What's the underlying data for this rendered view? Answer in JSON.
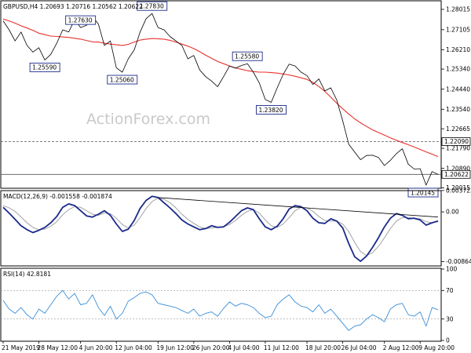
{
  "header": {
    "price_title": "GBPUSD,H4  1.20693 1.20716 1.20562 1.20622",
    "macd_title": "MACD(12,26,9) -0.001558 -0.001874",
    "rsi_title": "RSI(14) 42.8181"
  },
  "watermark": "ActionForex.com",
  "colors": {
    "price": "#000000",
    "sma": "#e8322d",
    "macd": "#1a2a8c",
    "signal": "#9a9a9a",
    "trendline": "#000000",
    "rsi": "#3a8fd8",
    "label_border": "#1a2a8c",
    "current_price_box": "#000000"
  },
  "chart_data": [
    {
      "type": "line",
      "panel": "price",
      "ylim": [
        1.2,
        1.284
      ],
      "y_ticks": [
        "1.28015",
        "1.27105",
        "1.26210",
        "1.25340",
        "1.24440",
        "1.23540",
        "1.22665",
        "1.21790",
        "1.20890",
        "1.20015"
      ],
      "y_tick_values": [
        1.28015,
        1.27105,
        1.2621,
        1.2534,
        1.2444,
        1.2354,
        1.22665,
        1.2179,
        1.2089,
        1.20015
      ],
      "highlight_levels": [
        {
          "label": "1.22090",
          "value": 1.2209,
          "style": "dashed"
        },
        {
          "label": "1.20622",
          "value": 1.20622,
          "style": "solid",
          "box": true
        }
      ],
      "series": [
        {
          "key": "close",
          "color": "#000000",
          "values": [
            1.275,
            1.271,
            1.266,
            1.27,
            1.264,
            1.261,
            1.263,
            1.2575,
            1.26,
            1.265,
            1.271,
            1.27,
            1.2755,
            1.272,
            1.273,
            1.277,
            1.2735,
            1.264,
            1.266,
            1.254,
            1.252,
            1.258,
            1.262,
            1.27,
            1.276,
            1.2783,
            1.272,
            1.271,
            1.268,
            1.266,
            1.264,
            1.258,
            1.2595,
            1.253,
            1.25,
            1.248,
            1.2455,
            1.25,
            1.2548,
            1.2538,
            1.255,
            1.2558,
            1.252,
            1.2472,
            1.2398,
            1.2385,
            1.245,
            1.251,
            1.2556,
            1.2548,
            1.252,
            1.2505,
            1.2465,
            1.249,
            1.2436,
            1.245,
            1.2395,
            1.2302,
            1.2198,
            1.2162,
            1.2128,
            1.2147,
            1.2148,
            1.2138,
            1.2102,
            1.2125,
            1.2155,
            1.2177,
            1.2108,
            1.2086,
            1.2088,
            1.2014,
            1.2075,
            1.2062
          ]
        },
        {
          "key": "sma",
          "name": "",
          "color": "#e8322d",
          "values": [
            1.2758,
            1.275,
            1.274,
            1.2728,
            1.2718,
            1.2708,
            1.2695,
            1.2688,
            1.2682,
            1.268,
            1.2678,
            1.2676,
            1.2672,
            1.2668,
            1.2662,
            1.2656,
            1.2655,
            1.265,
            1.2646,
            1.2643,
            1.264,
            1.2645,
            1.2655,
            1.2664,
            1.2668,
            1.2671,
            1.267,
            1.2668,
            1.2663,
            1.2655,
            1.2646,
            1.2637,
            1.2626,
            1.2612,
            1.2596,
            1.2582,
            1.2568,
            1.2558,
            1.2548,
            1.2539,
            1.2533,
            1.2527,
            1.2523,
            1.252,
            1.252,
            1.2518,
            1.2516,
            1.2512,
            1.2508,
            1.2502,
            1.2495,
            1.2488,
            1.2474,
            1.2456,
            1.2434,
            1.2408,
            1.2381,
            1.2356,
            1.2333,
            1.2311,
            1.2293,
            1.2277,
            1.2262,
            1.225,
            1.2238,
            1.2226,
            1.2215,
            1.2205,
            1.2195,
            1.2185,
            1.2174,
            1.2163,
            1.2153,
            1.2142
          ]
        }
      ],
      "annotations": [
        {
          "text": "1.27630",
          "index": 13,
          "pos": "above"
        },
        {
          "text": "1.25590",
          "index": 7,
          "pos": "below"
        },
        {
          "text": "1.27830",
          "index": 25,
          "pos": "above"
        },
        {
          "text": "1.25060",
          "index": 20,
          "pos": "below"
        },
        {
          "text": "1.25580",
          "index": 41,
          "pos": "above"
        },
        {
          "text": "1.23820",
          "index": 45,
          "pos": "below"
        },
        {
          "text": "1.20145",
          "index": 71,
          "pos": "below"
        }
      ]
    },
    {
      "type": "line",
      "panel": "macd",
      "ylim": [
        -0.0094,
        0.0037
      ],
      "y_ticks": [
        "0.003722",
        "0.00",
        "-0.008643"
      ],
      "y_tick_values": [
        0.003722,
        0.0,
        -0.008643
      ],
      "series": [
        {
          "key": "macd",
          "name": "",
          "color": "#1a2a8c",
          "values": [
            0.0008,
            -0.0002,
            -0.0013,
            -0.0024,
            -0.0031,
            -0.0036,
            -0.0032,
            -0.0027,
            -0.0019,
            -0.0008,
            0.0008,
            0.0014,
            0.0011,
            0.0002,
            -0.0007,
            -0.0009,
            -0.0004,
            0.0002,
            -0.0006,
            -0.0021,
            -0.0034,
            -0.003,
            -0.0015,
            0.0006,
            0.002,
            0.0027,
            0.0025,
            0.0016,
            0.0007,
            -0.0003,
            -0.0014,
            -0.0021,
            -0.0026,
            -0.0031,
            -0.0029,
            -0.0024,
            -0.0027,
            -0.0026,
            -0.0018,
            -0.0008,
            0.0002,
            0.0007,
            0.0004,
            -0.0012,
            -0.0026,
            -0.0031,
            -0.0025,
            -0.0012,
            0.0005,
            0.0011,
            0.0009,
            0.0002,
            -0.0011,
            -0.0019,
            -0.002,
            -0.0012,
            -0.0016,
            -0.0028,
            -0.0055,
            -0.0078,
            -0.0086,
            -0.0077,
            -0.0062,
            -0.0045,
            -0.0026,
            -0.0011,
            -0.0003,
            -0.0006,
            -0.0012,
            -0.0011,
            -0.0014,
            -0.0023,
            -0.0019,
            -0.0016
          ]
        },
        {
          "key": "signal",
          "name": "",
          "color": "#9a9a9a",
          "values": [
            0.0011,
            0.0007,
            0.0001,
            -0.0009,
            -0.0019,
            -0.0027,
            -0.0031,
            -0.003,
            -0.0025,
            -0.0017,
            -0.0005,
            0.0004,
            0.0009,
            0.0008,
            0.0002,
            -0.0004,
            -0.0006,
            -0.0002,
            -0.0003,
            -0.0011,
            -0.0022,
            -0.0028,
            -0.0023,
            -0.001,
            0.0006,
            0.0018,
            0.0024,
            0.0022,
            0.0016,
            0.0007,
            -0.0004,
            -0.0013,
            -0.002,
            -0.0026,
            -0.0029,
            -0.0028,
            -0.0027,
            -0.0026,
            -0.0022,
            -0.0015,
            -0.0006,
            0.0001,
            0.0004,
            -0.0002,
            -0.0014,
            -0.0024,
            -0.0027,
            -0.0021,
            -0.001,
            0.0002,
            0.0008,
            0.0007,
            0.0001,
            -0.0008,
            -0.0015,
            -0.0016,
            -0.0016,
            -0.0021,
            -0.0034,
            -0.0053,
            -0.0069,
            -0.0076,
            -0.0071,
            -0.006,
            -0.0045,
            -0.0029,
            -0.0016,
            -0.001,
            -0.001,
            -0.0011,
            -0.0012,
            -0.0017,
            -0.0019,
            -0.0017
          ]
        }
      ],
      "trendline": {
        "from": {
          "index": 26,
          "value": 0.0025
        },
        "to": {
          "index": 73,
          "value": -0.0009
        }
      }
    },
    {
      "type": "line",
      "panel": "rsi",
      "ylim": [
        0,
        100
      ],
      "y_ticks": [
        "100",
        "70",
        "30",
        "0"
      ],
      "y_tick_values": [
        100,
        70,
        30,
        0
      ],
      "levels": [
        70,
        30
      ],
      "series": [
        {
          "key": "rsi",
          "name": "",
          "color": "#3a8fd8",
          "values": [
            56,
            44,
            38,
            46,
            36,
            30,
            44,
            38,
            50,
            62,
            70,
            58,
            66,
            50,
            52,
            64,
            46,
            35,
            48,
            30,
            38,
            55,
            60,
            66,
            68,
            64,
            52,
            50,
            48,
            46,
            42,
            38,
            44,
            34,
            38,
            40,
            34,
            45,
            54,
            48,
            52,
            50,
            46,
            38,
            32,
            34,
            50,
            58,
            64,
            54,
            48,
            46,
            40,
            50,
            38,
            44,
            34,
            24,
            14,
            20,
            22,
            30,
            36,
            32,
            26,
            44,
            50,
            52,
            36,
            34,
            40,
            20,
            46,
            43
          ]
        }
      ]
    }
  ],
  "x_axis": {
    "labels": [
      "21 May 2019",
      "28 May 12:00",
      "4 Jun 20:00",
      "12 Jun 04:00",
      "19 Jun 12:00",
      "26 Jun 20:00",
      "4 Jul 04:00",
      "11 Jul 12:00",
      "18 Jul 20:00",
      "26 Jul 04:00",
      "2 Aug 12:00",
      "9 Aug 20:00"
    ],
    "label_index": [
      0,
      6,
      13,
      19,
      26,
      32,
      38,
      44,
      51,
      57,
      64,
      70
    ]
  }
}
